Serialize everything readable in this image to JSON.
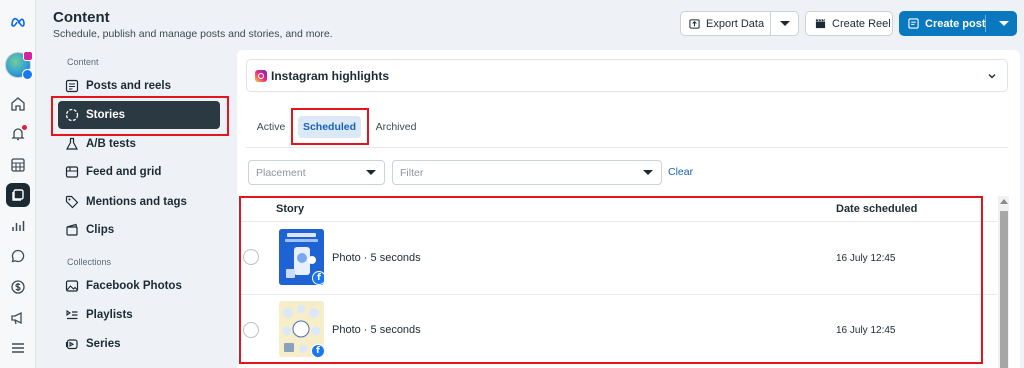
{
  "rail": {
    "items": [
      {
        "icon": "meta-logo-icon"
      },
      {
        "icon": "page-avatar"
      },
      {
        "icon": "home-icon"
      },
      {
        "icon": "notifications-icon"
      },
      {
        "icon": "grid-icon"
      },
      {
        "icon": "content-icon"
      },
      {
        "icon": "insights-icon"
      },
      {
        "icon": "inbox-icon"
      },
      {
        "icon": "monetization-icon"
      },
      {
        "icon": "ads-icon"
      },
      {
        "icon": "menu-icon"
      }
    ]
  },
  "header": {
    "title": "Content",
    "subtitle": "Schedule, publish and manage posts and stories, and more.",
    "export_label": "Export Data",
    "reel_label": "Create Reel",
    "create_label": "Create post"
  },
  "sidebar": {
    "content_section": "Content",
    "collections_section": "Collections",
    "items": [
      {
        "label": "Posts and reels",
        "icon": "posts-icon"
      },
      {
        "label": "Stories",
        "icon": "stories-icon"
      },
      {
        "label": "A/B tests",
        "icon": "flask-icon"
      },
      {
        "label": "Feed and grid",
        "icon": "feed-icon"
      },
      {
        "label": "Mentions and tags",
        "icon": "tag-icon"
      },
      {
        "label": "Clips",
        "icon": "clips-icon"
      },
      {
        "label": "Facebook Photos",
        "icon": "photo-icon"
      },
      {
        "label": "Playlists",
        "icon": "playlist-icon"
      },
      {
        "label": "Series",
        "icon": "series-icon"
      }
    ]
  },
  "main": {
    "account_label": "Instagram highlights",
    "tabs": [
      {
        "label": "Active"
      },
      {
        "label": "Scheduled"
      },
      {
        "label": "Archived"
      }
    ],
    "placement_placeholder": "Placement",
    "filter_placeholder": "Filter",
    "clear_label": "Clear",
    "columns": {
      "story": "Story",
      "date": "Date scheduled"
    },
    "rows": [
      {
        "title": "Photo · 5 seconds",
        "date": "16 July 12:45"
      },
      {
        "title": "Photo · 5 seconds",
        "date": "16 July 12:45"
      }
    ]
  },
  "colors": {
    "primary": "#0a78be",
    "active_nav": "#2b3a42",
    "highlight_red": "#e3161d",
    "tab_active_text": "#1463b8"
  }
}
